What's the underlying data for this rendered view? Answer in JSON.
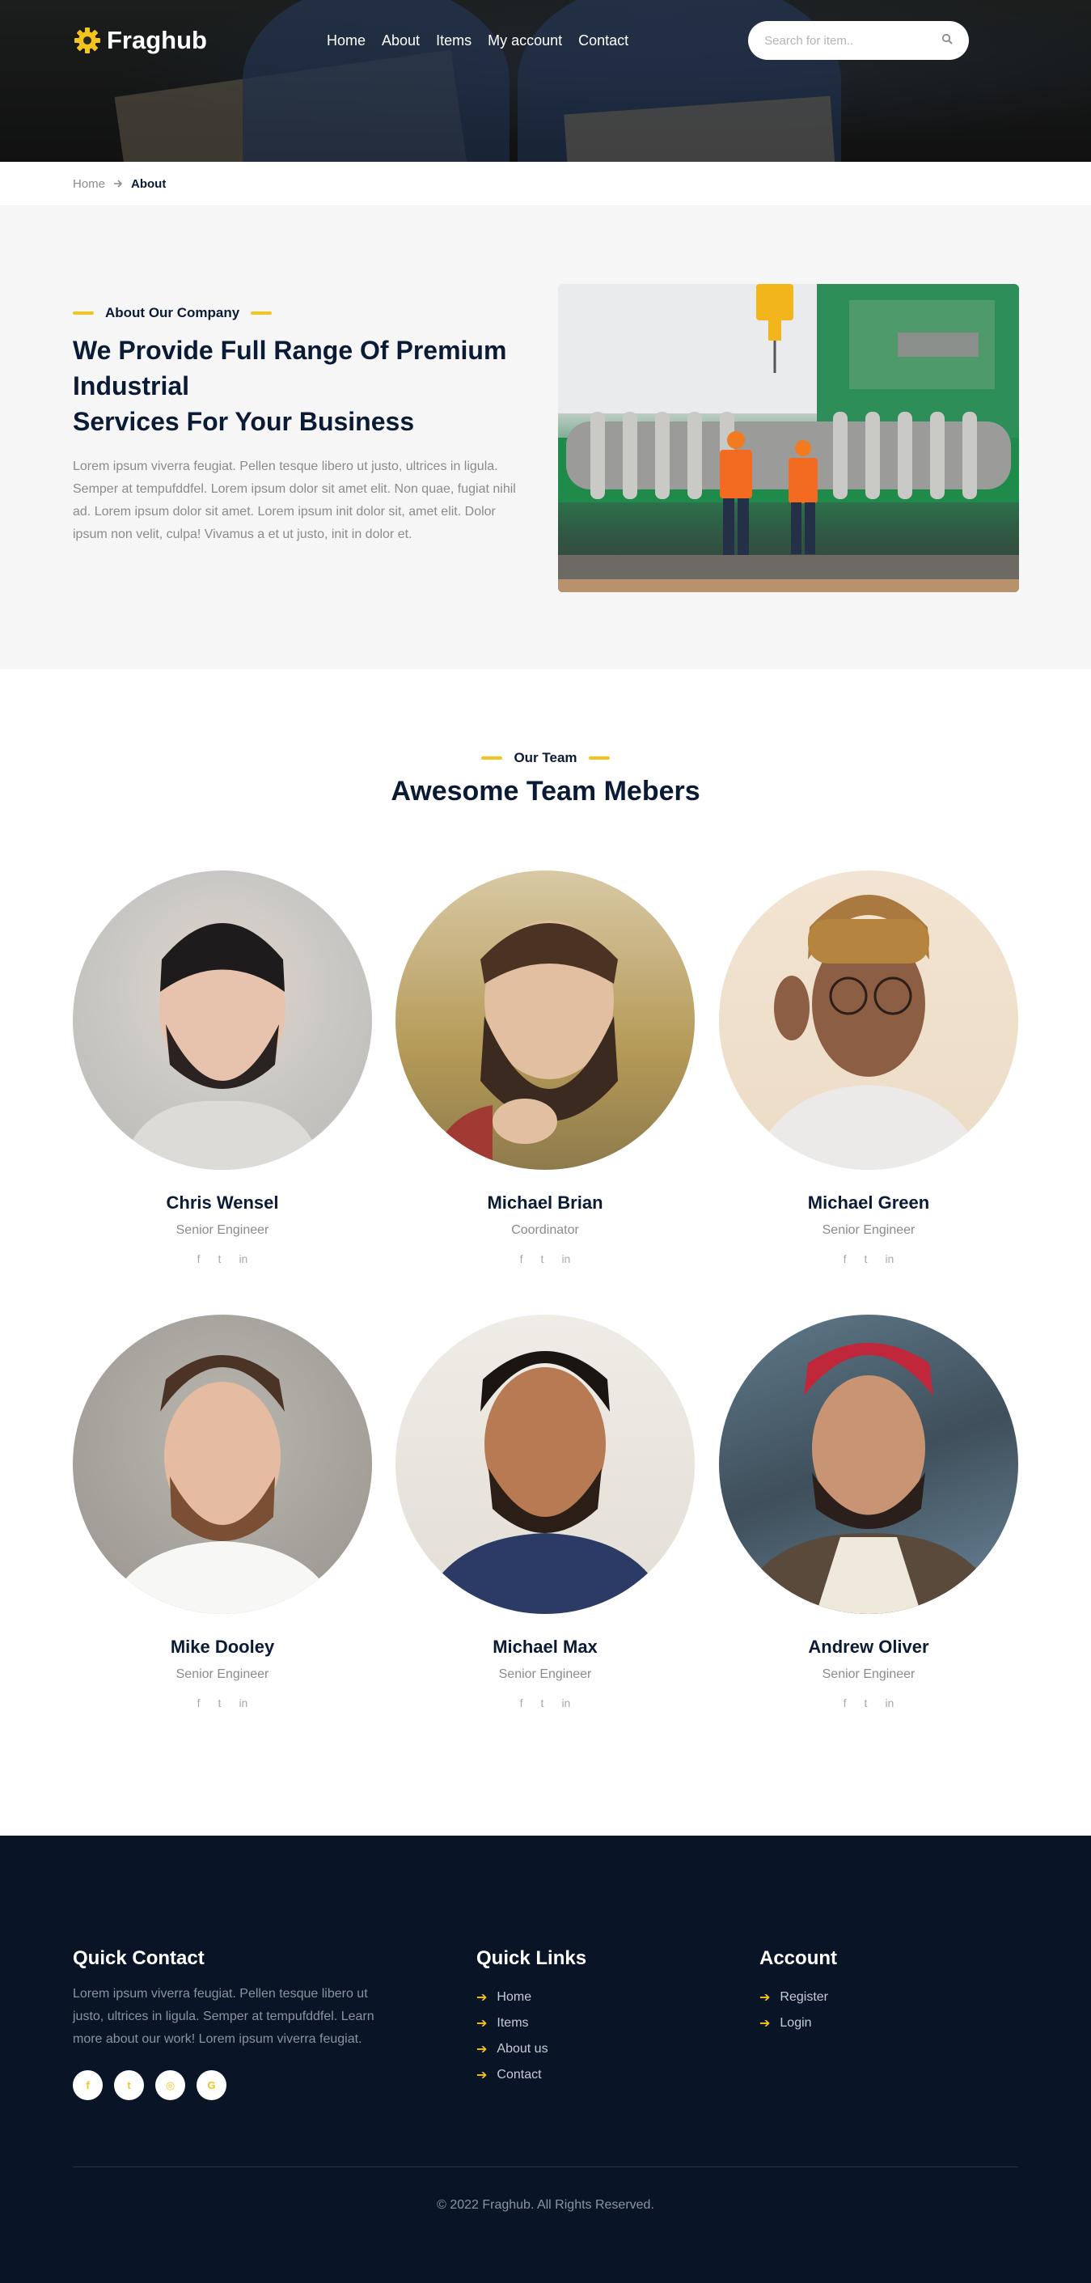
{
  "brand": {
    "name": "Fraghub",
    "accent": "#f5c41c",
    "navy": "#0b1a35"
  },
  "nav": {
    "items": [
      "Home",
      "About",
      "Items",
      "My account",
      "Contact"
    ],
    "search_placeholder": "Search for item.."
  },
  "breadcrumb": {
    "home": "Home",
    "current": "About"
  },
  "about": {
    "eyebrow": "About Our Company",
    "title_line1": "We Provide Full Range Of Premium Industrial",
    "title_line2": "Services For Your Business",
    "description": "Lorem ipsum viverra feugiat. Pellen tesque libero ut justo, ultrices in ligula. Semper at tempufddfel. Lorem ipsum dolor sit amet elit. Non quae, fugiat nihil ad. Lorem ipsum dolor sit amet. Lorem ipsum init dolor sit, amet elit. Dolor ipsum non velit, culpa! Vivamus a et ut justo, init in dolor et."
  },
  "team": {
    "eyebrow": "Our Team",
    "title": "Awesome Team Mebers",
    "members": [
      {
        "name": "Chris Wensel",
        "role": "Senior Engineer"
      },
      {
        "name": "Michael Brian",
        "role": "Coordinator"
      },
      {
        "name": "Michael Green",
        "role": "Senior Engineer"
      },
      {
        "name": "Mike Dooley",
        "role": "Senior Engineer"
      },
      {
        "name": "Michael Max",
        "role": "Senior Engineer"
      },
      {
        "name": "Andrew Oliver",
        "role": "Senior Engineer"
      }
    ],
    "social_glyphs": [
      "f",
      "t",
      "in"
    ]
  },
  "footer": {
    "quick_contact": {
      "title": "Quick Contact",
      "text": "Lorem ipsum viverra feugiat. Pellen tesque libero ut justo, ultrices in ligula. Semper at tempufddfel. Learn more about our work! Lorem ipsum viverra feugiat.",
      "socials": [
        "f",
        "t",
        "◎",
        "G"
      ]
    },
    "quick_links": {
      "title": "Quick Links",
      "items": [
        "Home",
        "Items",
        "About us",
        "Contact"
      ]
    },
    "account": {
      "title": "Account",
      "items": [
        "Register",
        "Login"
      ]
    },
    "copyright": "© 2022 Fraghub. All Rights Reserved."
  }
}
